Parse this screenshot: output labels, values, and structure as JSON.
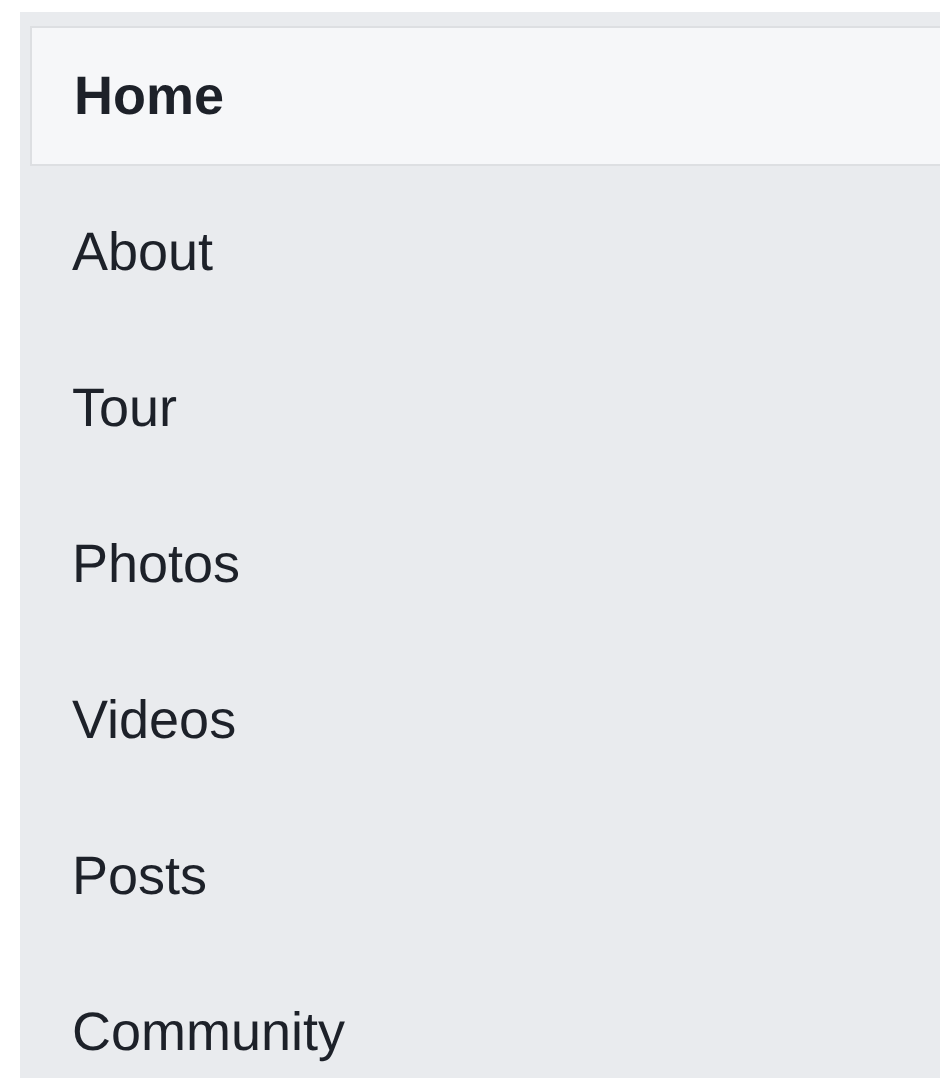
{
  "sidebar": {
    "items": [
      {
        "label": "Home",
        "selected": true
      },
      {
        "label": "About",
        "selected": false
      },
      {
        "label": "Tour",
        "selected": false
      },
      {
        "label": "Photos",
        "selected": false
      },
      {
        "label": "Videos",
        "selected": false
      },
      {
        "label": "Posts",
        "selected": false
      },
      {
        "label": "Community",
        "selected": false
      }
    ]
  }
}
